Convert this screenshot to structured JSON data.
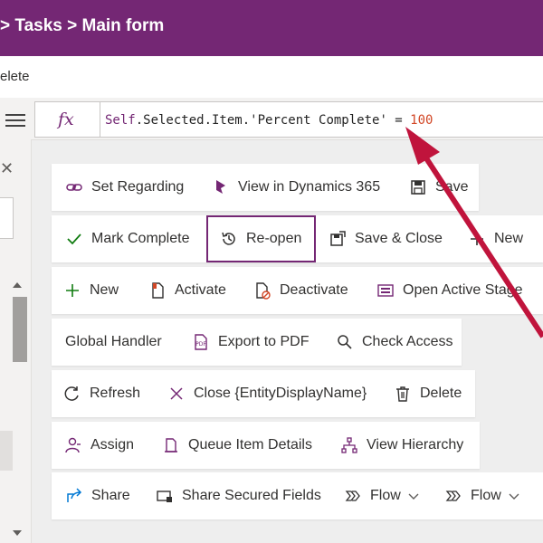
{
  "header": {
    "title": "> Tasks > Main form"
  },
  "command": {
    "delete_label": "elete"
  },
  "formula_bar": {
    "fx_label": "fx",
    "formula_self": "Self",
    "formula_mid": ".Selected.Item.",
    "formula_str": "'Percent Complete'",
    "formula_op": " = ",
    "formula_num": "100"
  },
  "left_panel": {
    "close_glyph": "✕"
  },
  "buttons": {
    "set_regarding": "Set Regarding",
    "view_in_dynamics": "View in Dynamics 365",
    "save": "Save",
    "mark_complete": "Mark Complete",
    "reopen": "Re-open",
    "save_close": "Save & Close",
    "new_1": "New",
    "new_2": "New",
    "activate": "Activate",
    "deactivate": "Deactivate",
    "open_active_stage": "Open Active Stage",
    "global_handler": "Global Handler",
    "export_pdf": "Export to PDF",
    "check_access": "Check Access",
    "refresh": "Refresh",
    "close_entity": "Close {EntityDisplayName}",
    "delete": "Delete",
    "assign": "Assign",
    "queue_item_details": "Queue Item Details",
    "view_hierarchy": "View Hierarchy",
    "share": "Share",
    "share_secured_fields": "Share Secured Fields",
    "flow_1": "Flow",
    "flow_2": "Flow"
  },
  "colors": {
    "brand": "#742774",
    "annotation_arrow": "#c0143c"
  },
  "selected_button": "Re-open"
}
